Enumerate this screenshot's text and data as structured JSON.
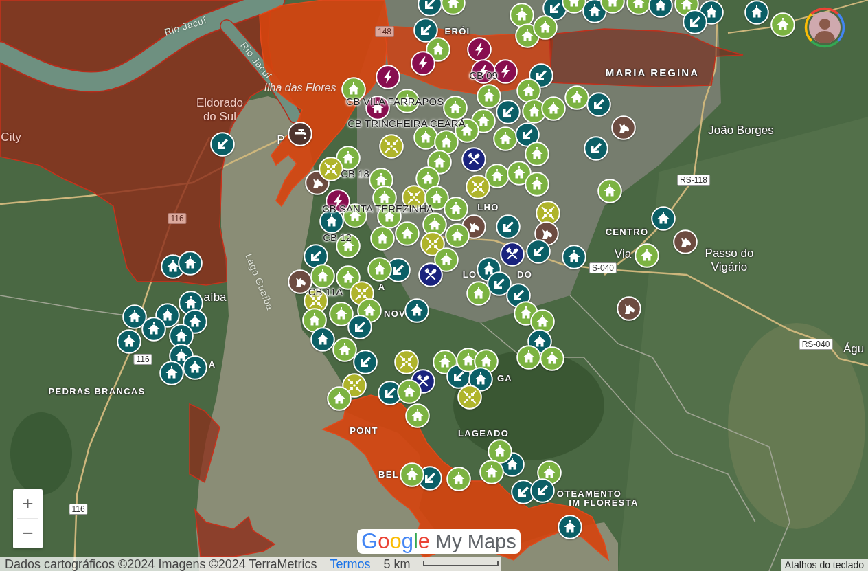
{
  "map": {
    "labels": [
      {
        "kind": "river",
        "text": "Rio Jacuí"
      },
      {
        "kind": "road_flooded",
        "text": "148"
      },
      {
        "kind": "district",
        "text": "ERÓI"
      },
      {
        "kind": "river",
        "text": "Rio Jacuí"
      },
      {
        "kind": "district_large",
        "text": "MARIA REGINA"
      },
      {
        "kind": "island",
        "text": "Ilha das Flores"
      },
      {
        "kind": "place_flooded",
        "text": "Eldorado do Sul"
      },
      {
        "kind": "place_flooded",
        "text": "City"
      },
      {
        "kind": "place",
        "text": "P"
      },
      {
        "kind": "place",
        "text": "João Borges"
      },
      {
        "kind": "road",
        "text": "RS-118"
      },
      {
        "kind": "district",
        "text": "LHO"
      },
      {
        "kind": "road_flooded",
        "text": "116"
      },
      {
        "kind": "district",
        "text": "CENTRO"
      },
      {
        "kind": "water",
        "text": "Lago Guaíba"
      },
      {
        "kind": "district",
        "text": "LO"
      },
      {
        "kind": "district",
        "text": "DO"
      },
      {
        "kind": "road",
        "text": "S-040"
      },
      {
        "kind": "place",
        "text": "Via"
      },
      {
        "kind": "place",
        "text": "Passo do Vigário"
      },
      {
        "kind": "place",
        "text": "aíba"
      },
      {
        "kind": "district",
        "text": "A"
      },
      {
        "kind": "district",
        "text": "NOV"
      },
      {
        "kind": "road",
        "text": "RS-040"
      },
      {
        "kind": "place",
        "text": "Águ"
      },
      {
        "kind": "road",
        "text": "116"
      },
      {
        "kind": "district",
        "text": "A"
      },
      {
        "kind": "district",
        "text": "GA"
      },
      {
        "kind": "district",
        "text": "PEDRAS BRANCAS"
      },
      {
        "kind": "district",
        "text": "PONT"
      },
      {
        "kind": "district",
        "text": "LAGEADO"
      },
      {
        "kind": "district",
        "text": "BEL"
      },
      {
        "kind": "district",
        "text": "OTEAMENTO"
      },
      {
        "kind": "district",
        "text": "IM FLORESTA"
      },
      {
        "kind": "road",
        "text": "116"
      }
    ],
    "markers": [
      {
        "kind": "arrow",
        "color": "#0b5f66"
      },
      {
        "kind": "house",
        "color": "#7cb342"
      },
      {
        "kind": "house",
        "color": "#7cb342"
      },
      {
        "kind": "arrow",
        "color": "#0b5f66"
      },
      {
        "kind": "house",
        "color": "#7cb342"
      },
      {
        "kind": "house",
        "color": "#0b5f66"
      },
      {
        "kind": "house",
        "color": "#7cb342"
      },
      {
        "kind": "house",
        "color": "#7cb342"
      },
      {
        "kind": "house",
        "color": "#0b5f66"
      },
      {
        "kind": "house",
        "color": "#7cb342"
      },
      {
        "kind": "house",
        "color": "#0b5f66"
      },
      {
        "kind": "arrow",
        "color": "#0b5f66"
      },
      {
        "kind": "house",
        "color": "#0b5f66"
      },
      {
        "kind": "house",
        "color": "#7cb342"
      },
      {
        "kind": "arrow",
        "color": "#0b5f66"
      },
      {
        "kind": "house",
        "color": "#7cb342"
      },
      {
        "kind": "house",
        "color": "#7cb342"
      },
      {
        "kind": "house",
        "color": "#7cb342"
      },
      {
        "kind": "bolt",
        "color": "#880e4f"
      },
      {
        "kind": "bolt",
        "color": "#880e4f"
      },
      {
        "kind": "bolt",
        "color": "#880e4f"
      },
      {
        "kind": "bolt",
        "color": "#880e4f"
      },
      {
        "kind": "bolt",
        "color": "#880e4f"
      },
      {
        "kind": "house",
        "color": "#7cb342"
      },
      {
        "kind": "arrow",
        "color": "#0b5f66"
      },
      {
        "kind": "house",
        "color": "#7cb342"
      },
      {
        "kind": "house",
        "color": "#7cb342"
      },
      {
        "kind": "house",
        "color": "#880e4f"
      },
      {
        "kind": "house",
        "color": "#7cb342"
      },
      {
        "kind": "house",
        "color": "#7cb342"
      },
      {
        "kind": "arrow",
        "color": "#0b5f66"
      },
      {
        "kind": "house",
        "color": "#7cb342"
      },
      {
        "kind": "arrow",
        "color": "#0b5f66"
      },
      {
        "kind": "house",
        "color": "#7cb342"
      },
      {
        "kind": "house",
        "color": "#7cb342"
      },
      {
        "kind": "house",
        "color": "#7cb342"
      },
      {
        "kind": "house",
        "color": "#7cb342"
      },
      {
        "kind": "house",
        "color": "#7cb342"
      },
      {
        "kind": "house",
        "color": "#7cb342"
      },
      {
        "kind": "tap",
        "color": "#4e342e"
      },
      {
        "kind": "arrow",
        "color": "#0b5f66"
      },
      {
        "kind": "house",
        "color": "#7cb342"
      },
      {
        "kind": "arrow",
        "color": "#0b5f66"
      },
      {
        "kind": "animal",
        "color": "#6d4c41"
      },
      {
        "kind": "converge",
        "color": "#afb42b"
      },
      {
        "kind": "house",
        "color": "#7cb342"
      },
      {
        "kind": "arrow",
        "color": "#0b5f66"
      },
      {
        "kind": "house",
        "color": "#7cb342"
      },
      {
        "kind": "cutlery",
        "color": "#1a237e"
      },
      {
        "kind": "animal",
        "color": "#6d4c41"
      },
      {
        "kind": "converge",
        "color": "#afb42b"
      },
      {
        "kind": "house",
        "color": "#7cb342"
      },
      {
        "kind": "house",
        "color": "#7cb342"
      },
      {
        "kind": "house",
        "color": "#7cb342"
      },
      {
        "kind": "house",
        "color": "#7cb342"
      },
      {
        "kind": "house",
        "color": "#7cb342"
      },
      {
        "kind": "house",
        "color": "#7cb342"
      },
      {
        "kind": "converge",
        "color": "#afb42b"
      },
      {
        "kind": "house",
        "color": "#7cb342"
      },
      {
        "kind": "converge",
        "color": "#afb42b"
      },
      {
        "kind": "house",
        "color": "#7cb342"
      },
      {
        "kind": "bolt",
        "color": "#880e4f"
      },
      {
        "kind": "house",
        "color": "#7cb342"
      },
      {
        "kind": "house",
        "color": "#7cb342"
      },
      {
        "kind": "house",
        "color": "#7cb342"
      },
      {
        "kind": "house",
        "color": "#7cb342"
      },
      {
        "kind": "converge",
        "color": "#afb42b"
      },
      {
        "kind": "house",
        "color": "#0b5f66"
      },
      {
        "kind": "house",
        "color": "#7cb342"
      },
      {
        "kind": "animal",
        "color": "#6d4c41"
      },
      {
        "kind": "arrow",
        "color": "#0b5f66"
      },
      {
        "kind": "house",
        "color": "#0b5f66"
      },
      {
        "kind": "house",
        "color": "#7cb342"
      },
      {
        "kind": "house",
        "color": "#7cb342"
      },
      {
        "kind": "house",
        "color": "#7cb342"
      },
      {
        "kind": "converge",
        "color": "#afb42b"
      },
      {
        "kind": "house",
        "color": "#7cb342"
      },
      {
        "kind": "animal",
        "color": "#6d4c41"
      },
      {
        "kind": "animal",
        "color": "#6d4c41"
      },
      {
        "kind": "house",
        "color": "#0b5f66"
      },
      {
        "kind": "arrow",
        "color": "#0b5f66"
      },
      {
        "kind": "house",
        "color": "#7cb342"
      },
      {
        "kind": "cutlery",
        "color": "#1a237e"
      },
      {
        "kind": "arrow",
        "color": "#0b5f66"
      },
      {
        "kind": "house",
        "color": "#7cb342"
      },
      {
        "kind": "arrow",
        "color": "#0b5f66"
      },
      {
        "kind": "cutlery",
        "color": "#1a237e"
      },
      {
        "kind": "house",
        "color": "#7cb342"
      },
      {
        "kind": "house",
        "color": "#7cb342"
      },
      {
        "kind": "house",
        "color": "#7cb342"
      },
      {
        "kind": "animal",
        "color": "#6d4c41"
      },
      {
        "kind": "house",
        "color": "#0b5f66"
      },
      {
        "kind": "arrow",
        "color": "#0b5f66"
      },
      {
        "kind": "house",
        "color": "#0b5f66"
      },
      {
        "kind": "house",
        "color": "#0b5f66"
      },
      {
        "kind": "house",
        "color": "#7cb342"
      },
      {
        "kind": "arrow",
        "color": "#0b5f66"
      },
      {
        "kind": "converge",
        "color": "#afb42b"
      },
      {
        "kind": "converge",
        "color": "#afb42b"
      },
      {
        "kind": "house",
        "color": "#7cb342"
      },
      {
        "kind": "house",
        "color": "#0b5f66"
      },
      {
        "kind": "house",
        "color": "#0b5f66"
      },
      {
        "kind": "house",
        "color": "#7cb342"
      },
      {
        "kind": "house",
        "color": "#7cb342"
      },
      {
        "kind": "animal",
        "color": "#6d4c41"
      },
      {
        "kind": "house",
        "color": "#7cb342"
      },
      {
        "kind": "house",
        "color": "#7cb342"
      },
      {
        "kind": "arrow",
        "color": "#0b5f66"
      },
      {
        "kind": "house",
        "color": "#0b5f66"
      },
      {
        "kind": "house",
        "color": "#0b5f66"
      },
      {
        "kind": "house",
        "color": "#0b5f66"
      },
      {
        "kind": "house",
        "color": "#0b5f66"
      },
      {
        "kind": "house",
        "color": "#0b5f66"
      },
      {
        "kind": "house",
        "color": "#0b5f66"
      },
      {
        "kind": "house",
        "color": "#0b5f66"
      },
      {
        "kind": "house",
        "color": "#0b5f66"
      },
      {
        "kind": "house",
        "color": "#7cb342"
      },
      {
        "kind": "arrow",
        "color": "#0b5f66"
      },
      {
        "kind": "house",
        "color": "#7cb342"
      },
      {
        "kind": "house",
        "color": "#7cb342"
      },
      {
        "kind": "house",
        "color": "#0b5f66"
      },
      {
        "kind": "house",
        "color": "#0b5f66"
      },
      {
        "kind": "house",
        "color": "#0b5f66"
      },
      {
        "kind": "converge",
        "color": "#afb42b"
      },
      {
        "kind": "house",
        "color": "#7cb342"
      },
      {
        "kind": "arrow",
        "color": "#0b5f66"
      },
      {
        "kind": "house",
        "color": "#7cb342"
      },
      {
        "kind": "house",
        "color": "#7cb342"
      },
      {
        "kind": "house",
        "color": "#0b5f66"
      },
      {
        "kind": "cutlery",
        "color": "#1a237e"
      },
      {
        "kind": "converge",
        "color": "#afb42b"
      },
      {
        "kind": "arrow",
        "color": "#0b5f66"
      },
      {
        "kind": "house",
        "color": "#7cb342"
      },
      {
        "kind": "converge",
        "color": "#afb42b"
      },
      {
        "kind": "house",
        "color": "#7cb342"
      },
      {
        "kind": "house",
        "color": "#7cb342"
      },
      {
        "kind": "house",
        "color": "#0b5f66"
      },
      {
        "kind": "house",
        "color": "#7cb342"
      },
      {
        "kind": "house",
        "color": "#7cb342"
      },
      {
        "kind": "house",
        "color": "#7cb342"
      },
      {
        "kind": "arrow",
        "color": "#0b5f66"
      },
      {
        "kind": "house",
        "color": "#7cb342"
      },
      {
        "kind": "house",
        "color": "#7cb342"
      },
      {
        "kind": "arrow",
        "color": "#0b5f66"
      },
      {
        "kind": "arrow",
        "color": "#0b5f66"
      },
      {
        "kind": "house",
        "color": "#0b5f66"
      }
    ],
    "marker_labels": [
      "CB 09",
      "CB VILA FARRAPOS",
      "CB TRINCHEIRA CEARÁ",
      "CB 18",
      "CB SANTA TEREZINHA",
      "CB 12",
      "CB 11A"
    ]
  },
  "zoom_controls": {
    "zoom_in": "+",
    "zoom_out": "−"
  },
  "logo": {
    "brand": "Google",
    "product": "My Maps"
  },
  "attribution": {
    "text": "Dados cartográficos ©2024 Imagens ©2024 TerraMetrics",
    "terms": "Termos",
    "scale": "5 km"
  },
  "keyboard_shortcuts": "Atalhos do teclado"
}
